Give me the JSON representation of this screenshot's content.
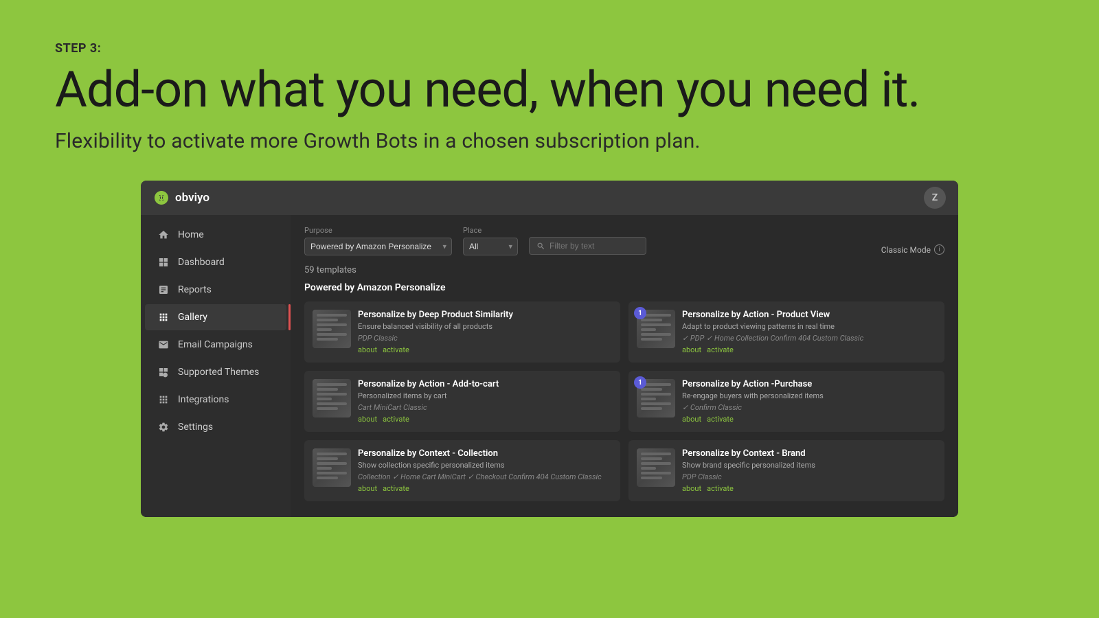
{
  "page": {
    "step_label": "STEP 3:",
    "main_heading": "Add-on what you need, when you need it.",
    "sub_heading": "Flexibility to activate more Growth Bots in a chosen subscription plan."
  },
  "app": {
    "title": "obviyo",
    "user_initial": "Z"
  },
  "sidebar": {
    "items": [
      {
        "id": "home",
        "label": "Home",
        "active": false
      },
      {
        "id": "dashboard",
        "label": "Dashboard",
        "active": false
      },
      {
        "id": "reports",
        "label": "Reports",
        "active": false
      },
      {
        "id": "gallery",
        "label": "Gallery",
        "active": true
      },
      {
        "id": "email-campaigns",
        "label": "Email Campaigns",
        "active": false
      },
      {
        "id": "supported-themes",
        "label": "Supported Themes",
        "active": false
      },
      {
        "id": "integrations",
        "label": "Integrations",
        "active": false
      },
      {
        "id": "settings",
        "label": "Settings",
        "active": false
      }
    ]
  },
  "filters": {
    "purpose_label": "Purpose",
    "purpose_value": "Powered by Amazon Personalize",
    "place_label": "Place",
    "place_value": "All",
    "search_placeholder": "Filter by text",
    "classic_mode_label": "Classic Mode",
    "templates_count": "59 templates"
  },
  "section": {
    "header": "Powered by Amazon Personalize"
  },
  "templates": [
    {
      "id": 1,
      "name": "Personalize by Deep Product Similarity",
      "desc": "Ensure balanced visibility of all products",
      "tags": "PDP  Classic",
      "has_badge": false,
      "about_label": "about",
      "activate_label": "activate"
    },
    {
      "id": 2,
      "name": "Personalize by Action - Product View",
      "desc": "Adapt to product viewing patterns in real time",
      "tags": "✓ PDP  ✓ Home  Collection  Confirm  404  Custom  Classic",
      "has_badge": true,
      "badge_value": "1",
      "about_label": "about",
      "activate_label": "activate"
    },
    {
      "id": 3,
      "name": "Personalize by Action - Add-to-cart",
      "desc": "Personalized items by cart",
      "tags": "Cart  MiniCart  Classic",
      "has_badge": false,
      "about_label": "about",
      "activate_label": "activate"
    },
    {
      "id": 4,
      "name": "Personalize by Action -Purchase",
      "desc": "Re-engage buyers with personalized items",
      "tags": "✓ Confirm  Classic",
      "has_badge": true,
      "badge_value": "1",
      "about_label": "about",
      "activate_label": "activate"
    },
    {
      "id": 5,
      "name": "Personalize by Context - Collection",
      "desc": "Show collection specific personalized items",
      "tags": "Collection  ✓ Home  Cart  MiniCart  ✓ Checkout  Confirm  404  Custom  Classic",
      "has_badge": false,
      "about_label": "about",
      "activate_label": "activate"
    },
    {
      "id": 6,
      "name": "Personalize by Context - Brand",
      "desc": "Show brand specific personalized items",
      "tags": "PDP  Classic",
      "has_badge": false,
      "about_label": "about",
      "activate_label": "activate"
    }
  ]
}
